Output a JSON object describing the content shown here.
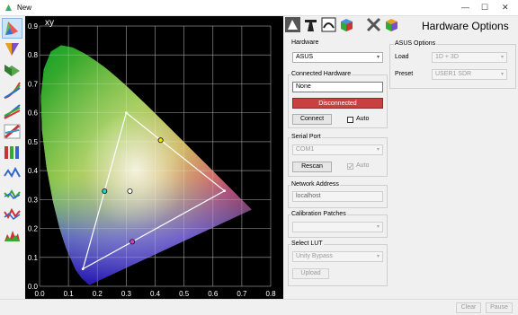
{
  "window": {
    "title": "New",
    "minimize_glyph": "—",
    "maximize_glyph": "☐",
    "close_glyph": "✕"
  },
  "toolbar": {
    "items": [
      "cie-chart-icon",
      "gamut-3d-icon",
      "volume-icon",
      "curves-icon",
      "rgb-balance-icon",
      "gradient-icon",
      "gamma-icon",
      "spectrum-icon",
      "waveform-icon",
      "dual-wave-icon",
      "levels-icon"
    ],
    "selected_index": 0
  },
  "plot": {
    "label": "xy",
    "x_ticks": [
      "0.0",
      "0.1",
      "0.2",
      "0.3",
      "0.4",
      "0.5",
      "0.6",
      "0.7",
      "0.8"
    ],
    "y_ticks": [
      "0.0",
      "0.1",
      "0.2",
      "0.3",
      "0.4",
      "0.5",
      "0.6",
      "0.7",
      "0.8",
      "0.9"
    ],
    "gamut_triangle": [
      [
        0.64,
        0.33
      ],
      [
        0.3,
        0.6
      ],
      [
        0.15,
        0.06
      ]
    ],
    "markers": [
      {
        "name": "white-point-marker",
        "x": 0.3127,
        "y": 0.329,
        "color": "#ffffff"
      },
      {
        "name": "yellow-marker",
        "x": 0.419,
        "y": 0.505,
        "color": "#f2e600"
      },
      {
        "name": "cyan-marker",
        "x": 0.225,
        "y": 0.329,
        "color": "#2ecbc9"
      },
      {
        "name": "magenta-marker",
        "x": 0.321,
        "y": 0.154,
        "color": "#d43bd4"
      }
    ]
  },
  "header": {
    "title": "Hardware Options",
    "tabs": [
      "cie-tab-icon",
      "tools-tab-icon",
      "calibration-tab-icon",
      "3d-tab-icon",
      "x-tab-icon",
      "cube-tab-icon"
    ]
  },
  "hardware": {
    "group": "Hardware",
    "value": "ASUS"
  },
  "connected": {
    "group": "Connected Hardware",
    "device": "None",
    "status": "Disconnected",
    "status_color": "#c84141",
    "connect": "Connect",
    "auto": "Auto"
  },
  "serial": {
    "group": "Serial Port",
    "port": "COM1",
    "rescan": "Rescan",
    "auto": "Auto"
  },
  "network": {
    "group": "Network Address",
    "address": "localhost"
  },
  "patches": {
    "group": "Calibration Patches",
    "value": ""
  },
  "lut": {
    "group": "Select LUT",
    "value": "Unity Bypass",
    "upload": "Upload"
  },
  "asus": {
    "group": "ASUS Options",
    "load_label": "Load",
    "load_value": "1D + 3D",
    "preset_label": "Preset",
    "preset_value": "USER1 SDR"
  },
  "footer": {
    "clear": "Clear",
    "pause": "Pause"
  }
}
